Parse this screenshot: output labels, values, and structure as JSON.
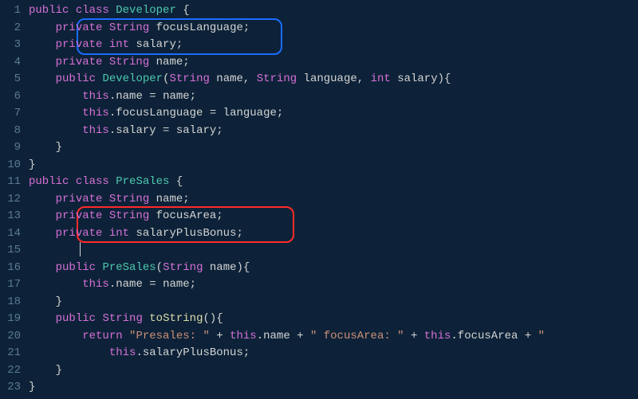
{
  "linenumbers": [
    "1",
    "2",
    "3",
    "4",
    "5",
    "6",
    "7",
    "8",
    "9",
    "10",
    "11",
    "12",
    "13",
    "14",
    "15",
    "16",
    "17",
    "18",
    "19",
    "20",
    "21",
    "22",
    "23"
  ],
  "code": {
    "l1": {
      "kw1": "public",
      "kw2": "class",
      "cls": "Developer",
      "brace": "{"
    },
    "l2": {
      "kw": "private",
      "type": "String",
      "id": "focusLanguage",
      "semi": ";"
    },
    "l3": {
      "kw": "private",
      "type": "int",
      "id": "salary",
      "semi": ";"
    },
    "l4": {
      "kw": "private",
      "type": "String",
      "id": "name",
      "semi": ";"
    },
    "l5": {
      "kw": "public",
      "cls": "Developer",
      "p1t": "String",
      "p1": "name",
      "c1": ", ",
      "p2t": "String",
      "p2": "language",
      "c2": ", ",
      "p3t": "int",
      "p3": "salary",
      "close": "){"
    },
    "l6": {
      "this": "this",
      "dot": ".",
      "prop": "name",
      "eq": " = ",
      "rhs": "name",
      "semi": ";"
    },
    "l7": {
      "this": "this",
      "dot": ".",
      "prop": "focusLanguage",
      "eq": " = ",
      "rhs": "language",
      "semi": ";"
    },
    "l8": {
      "this": "this",
      "dot": ".",
      "prop": "salary",
      "eq": " = ",
      "rhs": "salary",
      "semi": ";"
    },
    "l9": {
      "brace": "}"
    },
    "l10": {
      "brace": "}"
    },
    "l11": {
      "kw1": "public",
      "kw2": "class",
      "cls": "PreSales",
      "brace": "{"
    },
    "l12": {
      "kw": "private",
      "type": "String",
      "id": "name",
      "semi": ";"
    },
    "l13": {
      "kw": "private",
      "type": "String",
      "id": "focusArea",
      "semi": ";"
    },
    "l14": {
      "kw": "private",
      "type": "int",
      "id": "salaryPlusBonus",
      "semi": ";"
    },
    "l16": {
      "kw": "public",
      "cls": "PreSales",
      "p1t": "String",
      "p1": "name",
      "close": "){"
    },
    "l17": {
      "this": "this",
      "dot": ".",
      "prop": "name",
      "eq": " = ",
      "rhs": "name",
      "semi": ";"
    },
    "l18": {
      "brace": "}"
    },
    "l19": {
      "kw": "public",
      "type": "String",
      "method": "toString",
      "close": "(){"
    },
    "l20": {
      "ret": "return",
      "s1": "\"Presales: \"",
      "plus1": " + ",
      "this1": "this",
      "dot1": ".",
      "prop1": "name",
      "plus2": " + ",
      "s2": "\" focusArea: \"",
      "plus3": " + ",
      "this2": "this",
      "dot2": ".",
      "prop2": "focusArea",
      "plus4": " + ",
      "s3": "\" "
    },
    "l21": {
      "this": "this",
      "dot": ".",
      "prop": "salaryPlusBonus",
      "semi": ";"
    },
    "l22": {
      "brace": "}"
    },
    "l23": {
      "brace": "}"
    }
  },
  "highlights": {
    "blue_lines": "2-3",
    "red_lines": "13-14"
  }
}
